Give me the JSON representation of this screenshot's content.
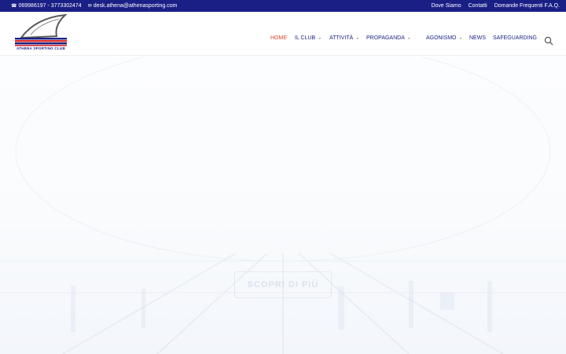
{
  "topbar": {
    "phone": "069986197 - 3773302474",
    "email": "desk.athena@athenasporting.com",
    "links": [
      "Dove Siamo",
      "Contatti",
      "Domande Frequenti F.A.Q."
    ]
  },
  "logo": {
    "text": "ATHENA SPORTING CLUB"
  },
  "nav": {
    "items": [
      {
        "label": "HOME",
        "has_dropdown": false,
        "active": true
      },
      {
        "label": "IL CLUB",
        "has_dropdown": true
      },
      {
        "label": "ATTIVITÀ",
        "has_dropdown": true
      },
      {
        "label": "PROPAGANDA",
        "has_dropdown": true
      },
      {
        "label": "AGONISMO",
        "has_dropdown": true
      },
      {
        "label": "NEWS",
        "has_dropdown": false
      },
      {
        "label": "SAFEGUARDING",
        "has_dropdown": false
      }
    ]
  },
  "hero": {
    "cta_label": "SCOPRI DI PIÙ"
  },
  "icons": {
    "phone": "phone-icon",
    "email": "mail-icon",
    "search": "search-icon",
    "chevron": "chevron-down-icon"
  },
  "colors": {
    "topbar_bg": "#1a1f86",
    "nav_text": "#1a1f86",
    "nav_active": "#e2462b"
  }
}
